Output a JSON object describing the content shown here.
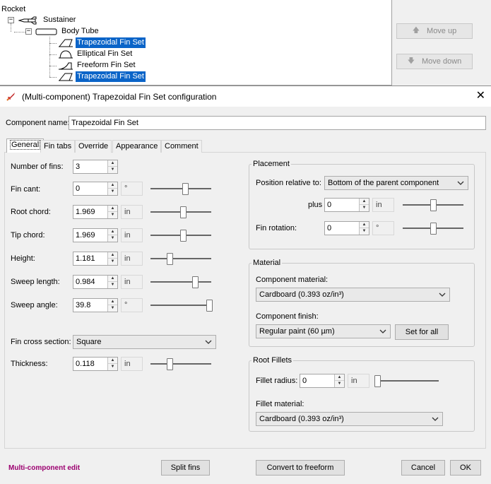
{
  "tree": {
    "nodes": [
      {
        "label": "Rocket",
        "selected": false
      },
      {
        "label": "Sustainer",
        "selected": false
      },
      {
        "label": "Body Tube",
        "selected": false
      },
      {
        "label": "Trapezoidal Fin Set",
        "selected": true
      },
      {
        "label": "Elliptical Fin Set",
        "selected": false
      },
      {
        "label": "Freeform Fin Set",
        "selected": false
      },
      {
        "label": "Trapezoidal Fin Set",
        "selected": true
      }
    ],
    "expander_glyph": "−",
    "move_up_label": "Move up",
    "move_down_label": "Move down",
    "up_arrow": "🡅",
    "down_arrow": "🡇"
  },
  "dialog": {
    "title": "(Multi-component) Trapezoidal Fin Set configuration",
    "close_glyph": "✕",
    "component_name_label": "Component name:",
    "component_name_value": "Trapezoidal Fin Set",
    "tabs": [
      {
        "label": "General",
        "active": true
      },
      {
        "label": "Fin tabs",
        "active": false
      },
      {
        "label": "Override",
        "active": false
      },
      {
        "label": "Appearance",
        "active": false
      },
      {
        "label": "Comment",
        "active": false
      }
    ]
  },
  "general": {
    "number_of_fins": {
      "label": "Number of fins:",
      "value": "3"
    },
    "fin_cant": {
      "label": "Fin cant:",
      "value": "0",
      "unit": "°",
      "slider_fraction": 0.58
    },
    "root_chord": {
      "label": "Root chord:",
      "value": "1.969",
      "unit": "in",
      "slider_fraction": 0.55
    },
    "tip_chord": {
      "label": "Tip chord:",
      "value": "1.969",
      "unit": "in",
      "slider_fraction": 0.55
    },
    "height": {
      "label": "Height:",
      "value": "1.181",
      "unit": "in",
      "slider_fraction": 0.3
    },
    "sweep_length": {
      "label": "Sweep length:",
      "value": "0.984",
      "unit": "in",
      "slider_fraction": 0.77
    },
    "sweep_angle": {
      "label": "Sweep angle:",
      "value": "39.8",
      "unit": "°",
      "slider_fraction": 1.0
    },
    "fin_cross_section": {
      "label": "Fin cross section:",
      "value": "Square"
    },
    "thickness": {
      "label": "Thickness:",
      "value": "0.118",
      "unit": "in",
      "slider_fraction": 0.3
    }
  },
  "placement": {
    "title": "Placement",
    "position_label": "Position relative to:",
    "position_value": "Bottom of the parent component",
    "plus_label": "plus",
    "plus_value": "0",
    "plus_unit": "in",
    "plus_slider_fraction": 0.5,
    "rotation_label": "Fin rotation:",
    "rotation_value": "0",
    "rotation_unit": "°",
    "rotation_slider_fraction": 0.5
  },
  "material": {
    "title": "Material",
    "component_material_label": "Component material:",
    "component_material_value": "Cardboard (0.393 oz/in³)",
    "component_finish_label": "Component finish:",
    "component_finish_value": "Regular paint (60 µm)",
    "set_for_all_label": "Set for all"
  },
  "root_fillets": {
    "title": "Root Fillets",
    "fillet_radius_label": "Fillet radius:",
    "fillet_radius_value": "0",
    "fillet_radius_unit": "in",
    "fillet_slider_fraction": 0.0,
    "fillet_material_label": "Fillet material:",
    "fillet_material_value": "Cardboard (0.393 oz/in³)"
  },
  "footer": {
    "multi_component_edit": "Multi-component edit",
    "split_fins_label": "Split fins",
    "convert_label": "Convert to freeform",
    "cancel_label": "Cancel",
    "ok_label": "OK"
  },
  "colors": {
    "selection": "#0a64c8",
    "multi_component_text": "#9c0070"
  },
  "icons": [
    "rocket-icon",
    "body-tube-icon",
    "trapezoidal-fin-icon",
    "elliptical-fin-icon",
    "freeform-fin-icon",
    "rocket-logo-icon",
    "close-icon",
    "chevron-down-icon",
    "spinner-up-icon",
    "spinner-down-icon",
    "arrow-up-icon",
    "arrow-down-icon"
  ]
}
